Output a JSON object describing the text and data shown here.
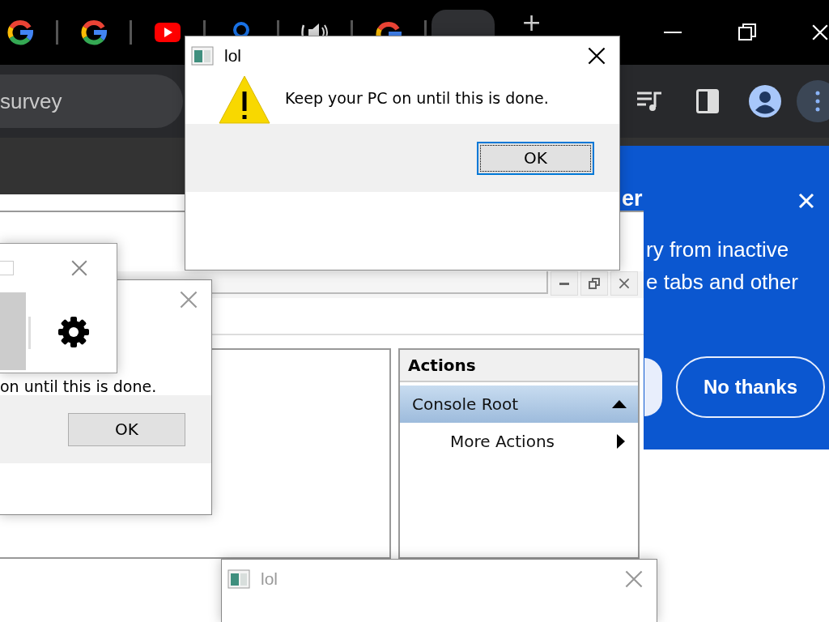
{
  "browser": {
    "tabs": [
      {
        "kind": "google",
        "selected": false
      },
      {
        "kind": "google",
        "selected": false
      },
      {
        "kind": "video",
        "selected": false
      },
      {
        "kind": "search",
        "selected": false
      },
      {
        "kind": "audio",
        "selected": false
      },
      {
        "kind": "google",
        "selected": false
      },
      {
        "kind": "blank",
        "selected": true
      }
    ],
    "new_tab": "+",
    "address": "survey"
  },
  "promo": {
    "heading": "er",
    "lines": [
      "ry from inactive",
      "e tabs and other"
    ],
    "button": "No thanks"
  },
  "console": {
    "actions_title": "Actions",
    "actions": [
      {
        "label": "Console Root",
        "kind": "group",
        "selected": true
      },
      {
        "label": "More Actions",
        "kind": "submenu",
        "selected": false
      }
    ]
  },
  "back_dialog": {
    "active": false,
    "message": "on until this is done.",
    "button": "OK",
    "focused": false
  },
  "main_dialog": {
    "title": "lol",
    "active": true,
    "message": "Keep your PC on until this is done.",
    "button": "OK",
    "focused": true
  },
  "bottom_dialog": {
    "title": "lol",
    "active": false
  }
}
